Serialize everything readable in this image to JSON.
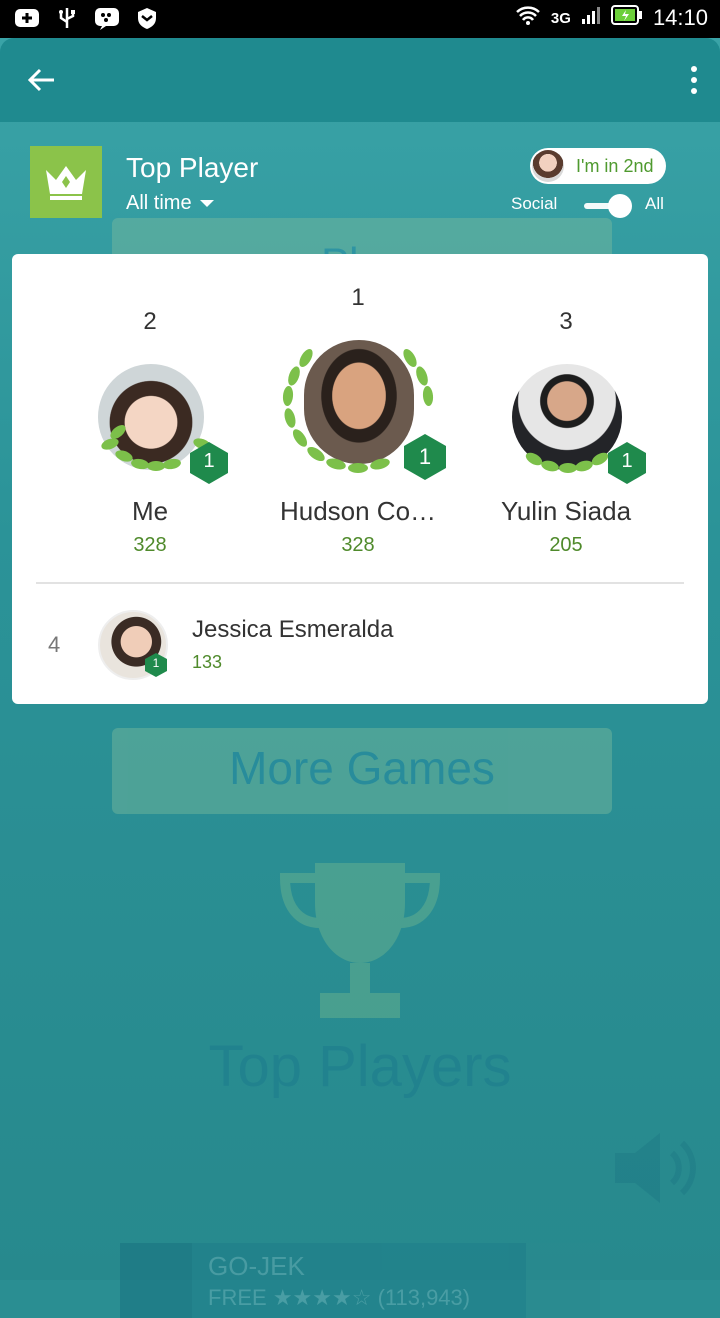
{
  "status": {
    "network": "3G",
    "time": "14:10"
  },
  "background": {
    "play_label": "Play",
    "more_games_label": "More Games",
    "top_players_label": "Top Players",
    "ad": {
      "title": "GO-JEK",
      "price": "FREE",
      "stars": "★★★★☆",
      "reviews": "(113,943)"
    }
  },
  "header": {
    "title": "Top Player",
    "period": "All time",
    "rank_pill": "I'm in 2nd",
    "toggle": {
      "left_label": "Social",
      "right_label": "All",
      "value": "All"
    }
  },
  "podium": [
    {
      "rank": "2",
      "name": "Me",
      "score": "328",
      "level": "1"
    },
    {
      "rank": "1",
      "name": "Hudson Co…",
      "score": "328",
      "level": "1"
    },
    {
      "rank": "3",
      "name": "Yulin Siada",
      "score": "205",
      "level": "1"
    }
  ],
  "list": [
    {
      "rank": "4",
      "name": "Jessica Esmeralda",
      "score": "133",
      "level": "1"
    }
  ],
  "colors": {
    "accent_green": "#8bc34a",
    "badge_green": "#1f8a4c",
    "teal": "#1f8a8f"
  }
}
